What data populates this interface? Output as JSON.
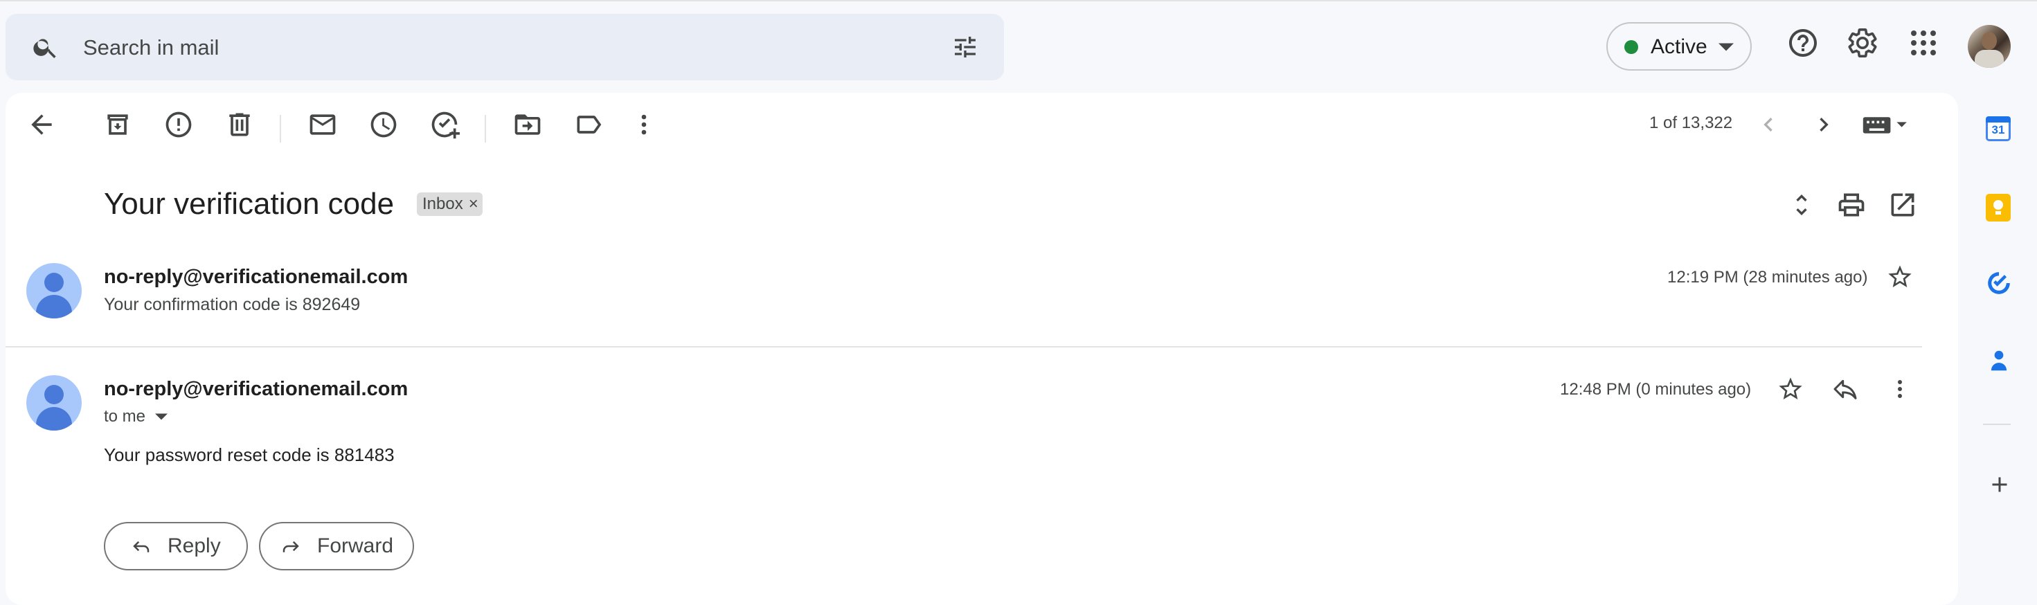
{
  "search": {
    "placeholder": "Search in mail"
  },
  "status": {
    "label": "Active",
    "color": "#1e8e3e"
  },
  "toolbar": {
    "counter": "1 of 13,322"
  },
  "thread": {
    "subject": "Your verification code",
    "label_chip": "Inbox",
    "label_chip_close": "×"
  },
  "messages": [
    {
      "sender": "no-reply@verificationemail.com",
      "snippet": "Your confirmation code is 892649",
      "time": "12:19 PM (28 minutes ago)"
    },
    {
      "sender": "no-reply@verificationemail.com",
      "recipient": "to me",
      "time": "12:48 PM (0 minutes ago)",
      "body": "Your password reset code is 881483"
    }
  ],
  "actions": {
    "reply": "Reply",
    "forward": "Forward"
  },
  "side_panel": {
    "calendar_day": "31"
  },
  "colors": {
    "accent": "#1a73e8",
    "search_bg": "#e9eef6",
    "page_bg": "#f6f8fc",
    "keep": "#fbbc04"
  }
}
